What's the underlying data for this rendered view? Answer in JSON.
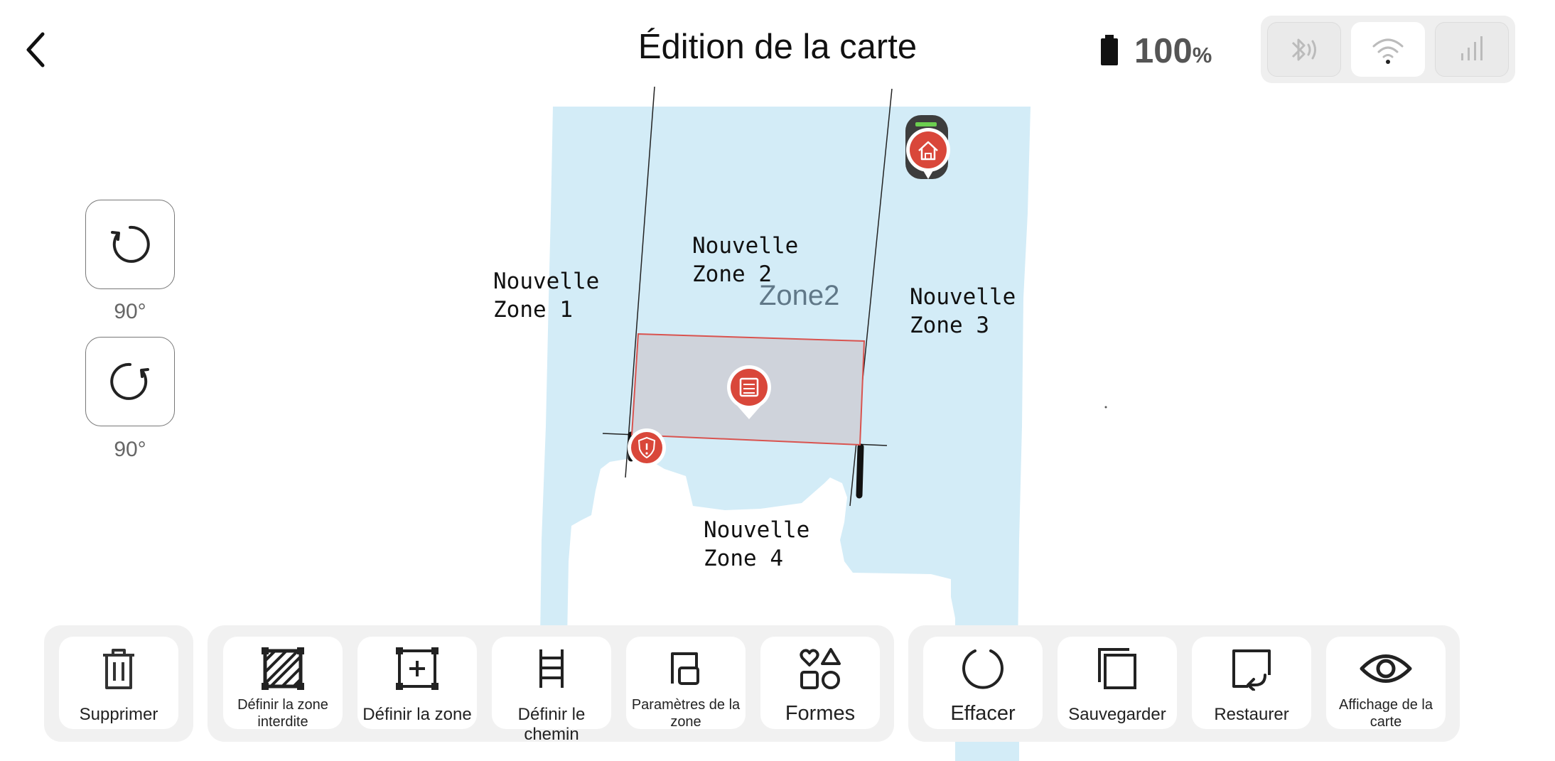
{
  "header": {
    "title": "Édition de la carte",
    "battery_value": "100",
    "battery_unit": "%",
    "connectivity": [
      {
        "name": "bluetooth-icon",
        "state": "inactive"
      },
      {
        "name": "wifi-icon",
        "state": "active"
      },
      {
        "name": "cellular-signal-icon",
        "state": "inactive"
      }
    ]
  },
  "rotate": {
    "ccw_label": "90°",
    "cw_label": "90°"
  },
  "map": {
    "zones": [
      {
        "line1": "Nouvelle",
        "line2": "Zone 1"
      },
      {
        "line1": "Nouvelle",
        "line2": "Zone 2"
      },
      {
        "line1": "Nouvelle",
        "line2": "Zone 3"
      },
      {
        "line1": "Nouvelle",
        "line2": "Zone 4"
      }
    ],
    "center_zone_name": "Zone2",
    "colors": {
      "lawn": "#d3ecf7",
      "selection_fill": "#cfd3db",
      "selection_border": "#d9534f",
      "marker": "#d9473a"
    }
  },
  "toolbar": {
    "delete": "Supprimer",
    "define_forbidden_zone": "Définir la zone interdite",
    "define_zone": "Définir la zone",
    "define_path": "Définir le chemin",
    "zone_settings": "Paramètres de la zone",
    "shapes": "Formes",
    "clear": "Effacer",
    "save": "Sauvegarder",
    "restore": "Restaurer",
    "map_display": "Affichage de la carte"
  }
}
